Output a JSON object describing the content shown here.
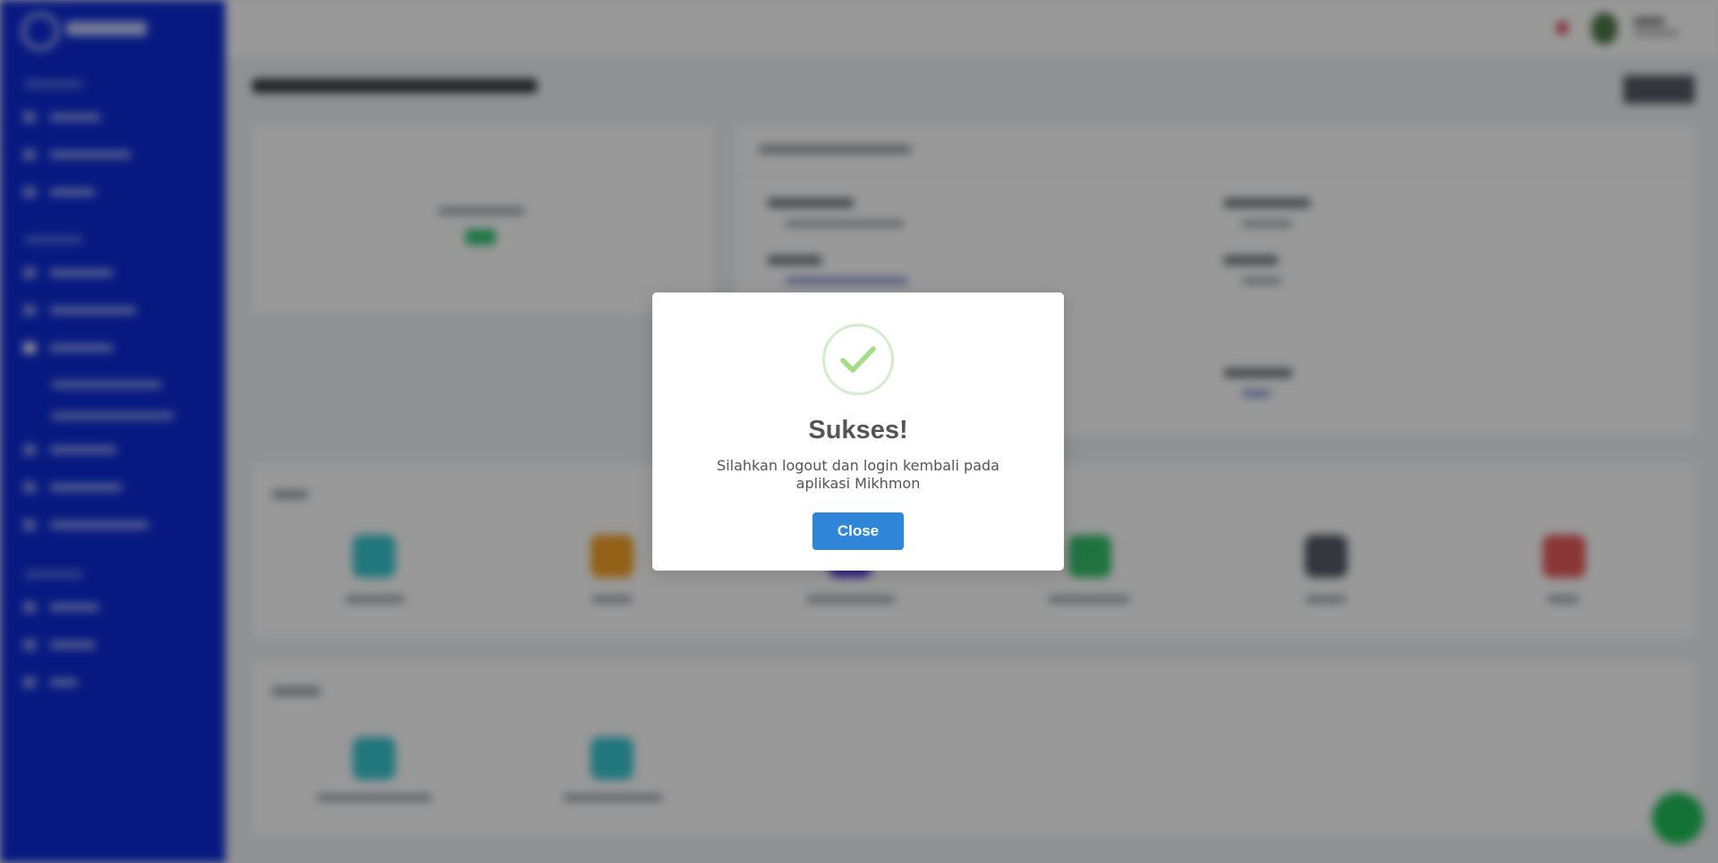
{
  "modal": {
    "title": "Sukses!",
    "message": "Silahkan logout dan login kembali pada aplikasi Mikhmon",
    "close_label": "Close",
    "icon": "success-checkmark-icon",
    "colors": {
      "confirm_button": "#2f86d8",
      "checkmark": "#a5dc86",
      "checkmark_ring": "#d3eccb"
    }
  },
  "background": {
    "sidebar_color": "#0c2bd6",
    "overlay": "dimmed and blurred application page behind dialog"
  }
}
